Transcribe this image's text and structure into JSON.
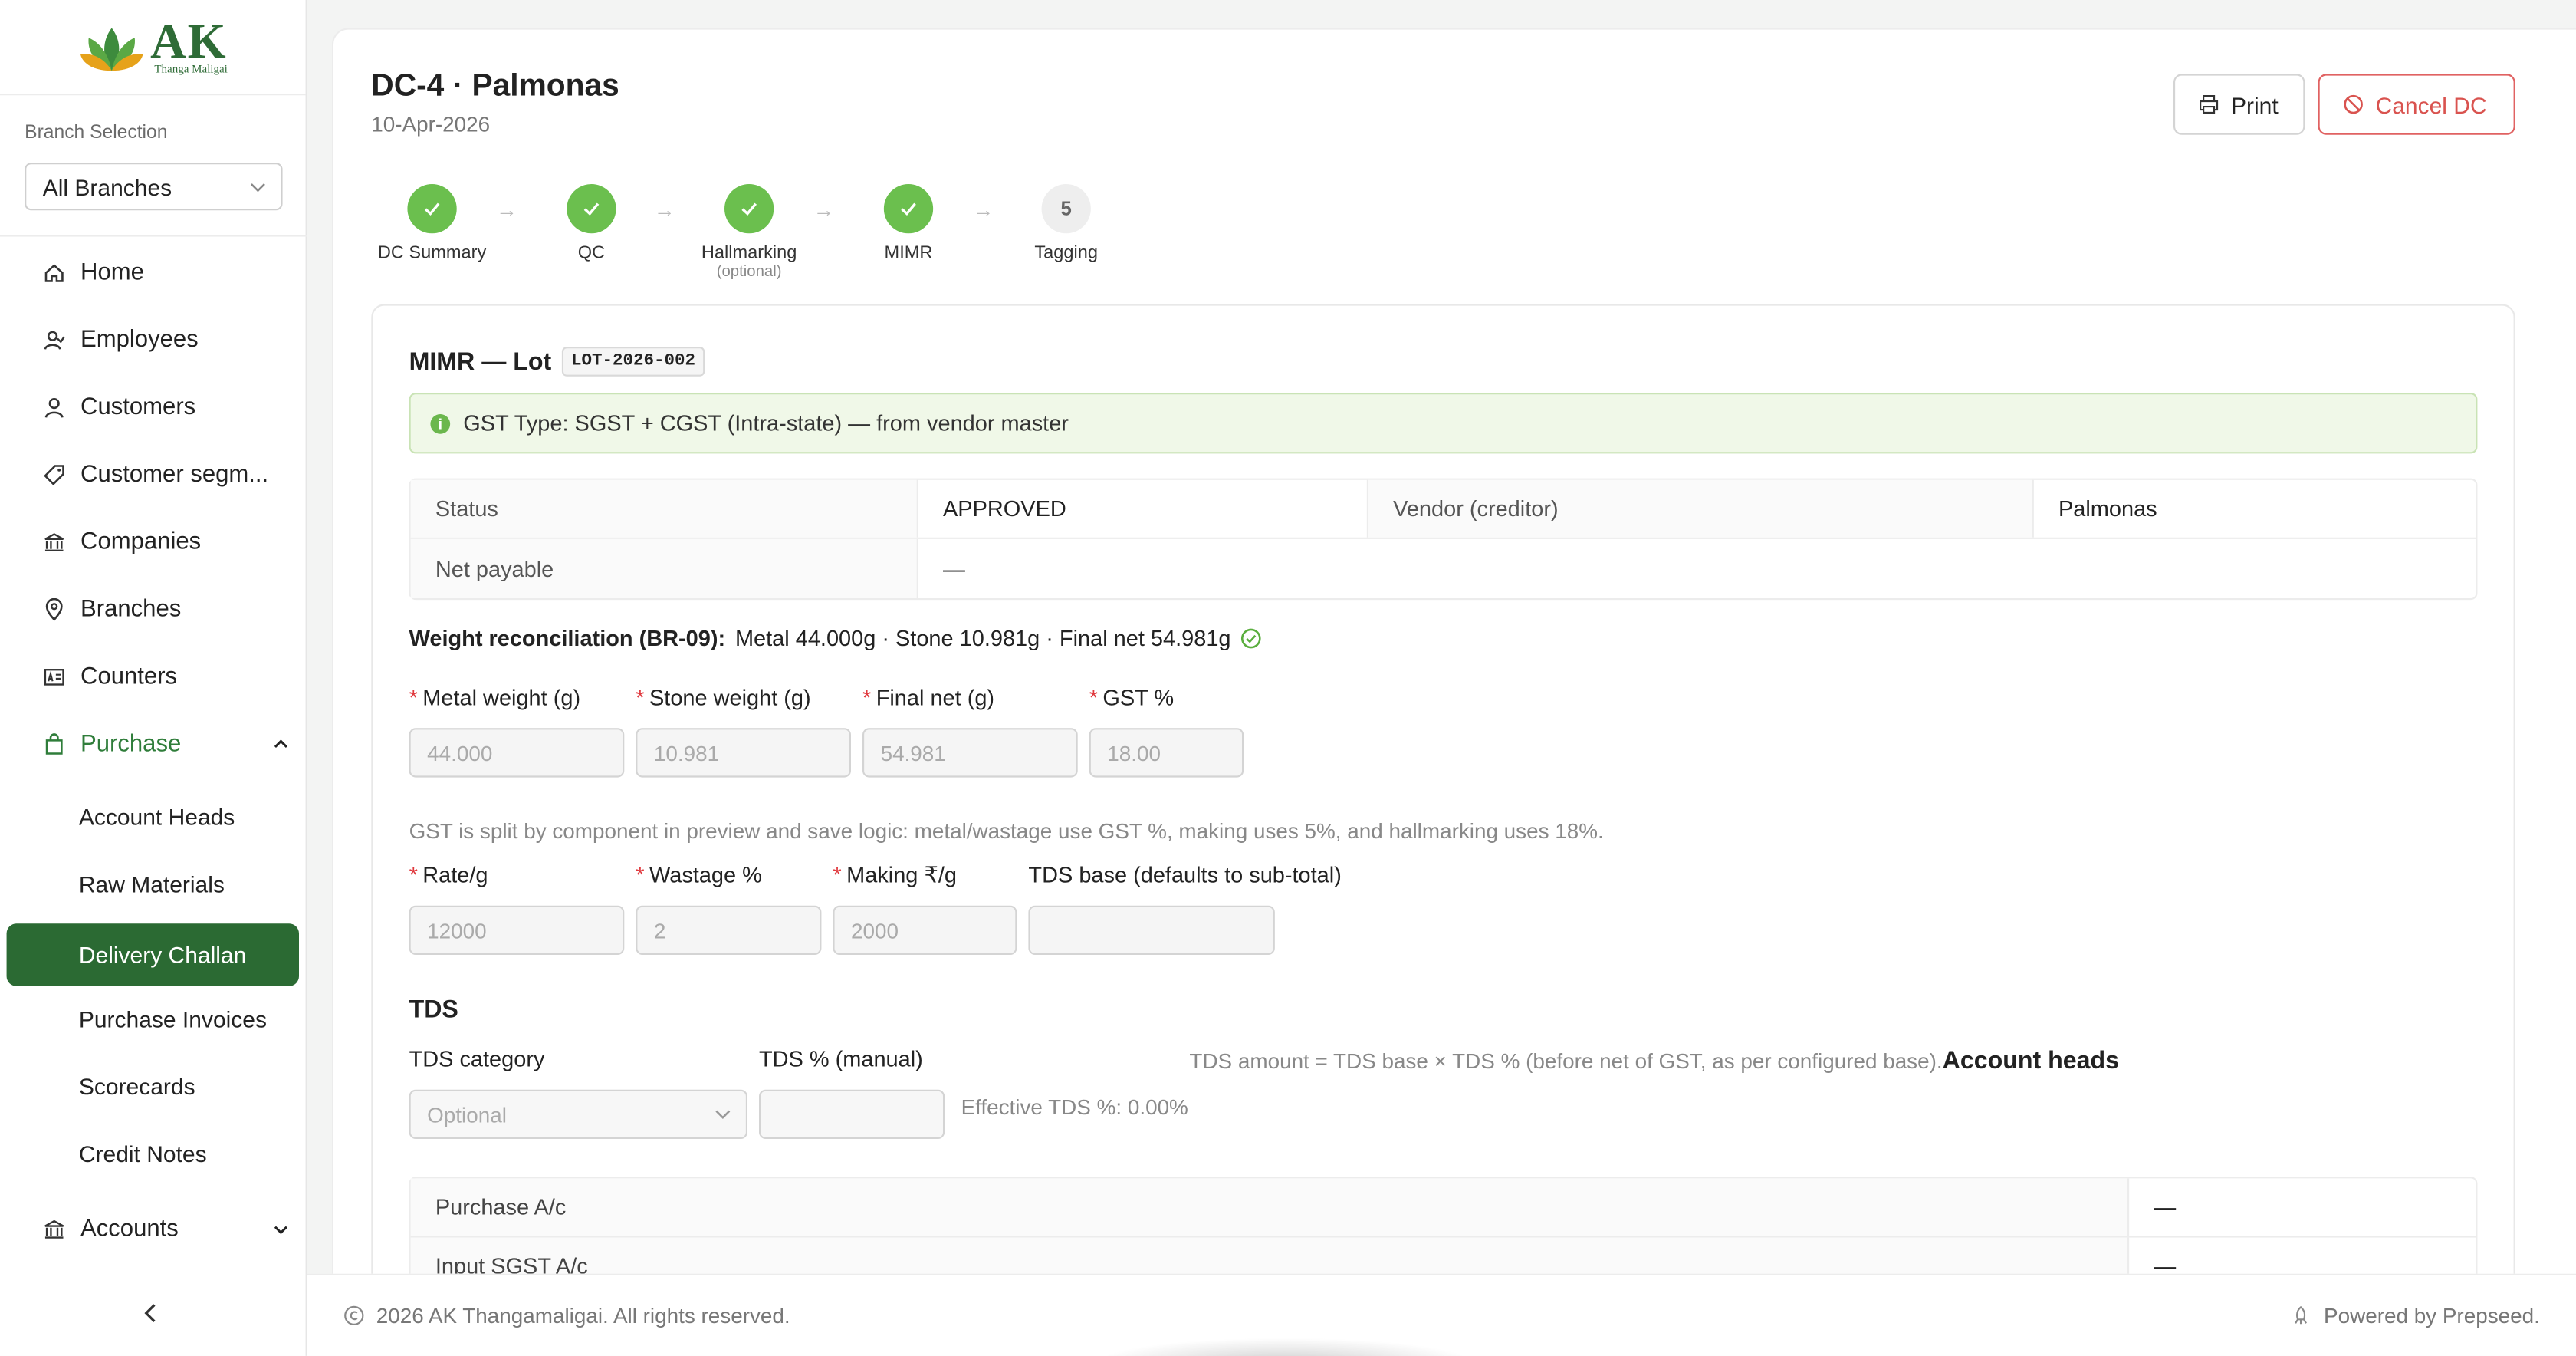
{
  "brand": {
    "name": "AK",
    "sub": "Thanga Maligai"
  },
  "branch": {
    "label": "Branch Selection",
    "selected": "All Branches"
  },
  "nav": {
    "home": "Home",
    "employees": "Employees",
    "customers": "Customers",
    "segments": "Customer segm...",
    "companies": "Companies",
    "branches": "Branches",
    "counters": "Counters",
    "purchase": "Purchase",
    "purchase_items": [
      "Account Heads",
      "Raw Materials",
      "Delivery Challan",
      "Purchase Invoices",
      "Scorecards",
      "Credit Notes"
    ],
    "accounts": "Accounts"
  },
  "header": {
    "title": "DC-4 · Palmonas",
    "date": "10-Apr-2026",
    "print_label": "Print",
    "cancel_label": "Cancel DC"
  },
  "steps": [
    {
      "label": "DC Summary",
      "hint": "",
      "state": "done"
    },
    {
      "label": "QC",
      "hint": "",
      "state": "done"
    },
    {
      "label": "Hallmarking",
      "hint": "(optional)",
      "state": "done"
    },
    {
      "label": "MIMR",
      "hint": "",
      "state": "done"
    },
    {
      "label": "Tagging",
      "hint": "",
      "state": "pending",
      "number": "5"
    }
  ],
  "mimr": {
    "title": "MIMR — Lot",
    "lot": "LOT-2026-002",
    "gst_alert": "GST Type: SGST + CGST (Intra-state) — from vendor master",
    "status_label": "Status",
    "status_value": "APPROVED",
    "vendor_label": "Vendor (creditor)",
    "vendor_value": "Palmonas",
    "net_label": "Net payable",
    "net_value": "—",
    "recon_label": "Weight reconciliation (BR-09):",
    "recon_text": "Metal 44.000g · Stone 10.981g · Final net 54.981g",
    "fields_row1": [
      {
        "label": "Metal weight (g)",
        "value": "44.000",
        "required": true
      },
      {
        "label": "Stone weight (g)",
        "value": "10.981",
        "required": true
      },
      {
        "label": "Final net (g)",
        "value": "54.981",
        "required": true
      },
      {
        "label": "GST %",
        "value": "18.00",
        "required": true
      }
    ],
    "gst_note": "GST is split by component in preview and save logic: metal/wastage use GST %, making uses 5%, and hallmarking uses 18%.",
    "fields_row2": [
      {
        "label": "Rate/g",
        "value": "12000",
        "required": true
      },
      {
        "label": "Wastage %",
        "value": "2",
        "required": true
      },
      {
        "label": "Making ₹/g",
        "value": "2000",
        "required": true
      },
      {
        "label": "TDS base (defaults to sub-total)",
        "value": "",
        "required": false
      }
    ]
  },
  "tds": {
    "title": "TDS",
    "category_label": "TDS category",
    "category_placeholder": "Optional",
    "manual_label": "TDS % (manual)",
    "formula": "TDS amount = TDS base × TDS % (before net of GST, as per configured base).",
    "effective": "Effective TDS %: 0.00%"
  },
  "accounts": {
    "title": "Account heads",
    "rows": [
      {
        "label": "Purchase A/c",
        "value": "—"
      },
      {
        "label": "Input SGST A/c",
        "value": "—"
      }
    ]
  },
  "footer": {
    "copyright": "2026 AK Thangamaligai. All rights reserved.",
    "powered": "Powered by Prepseed."
  }
}
